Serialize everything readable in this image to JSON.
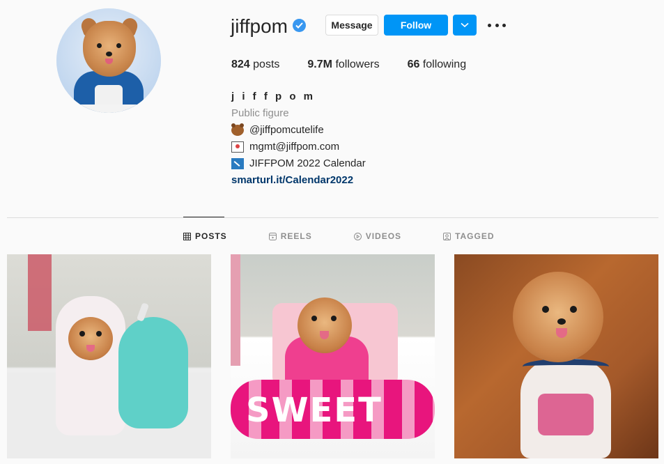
{
  "profile": {
    "username": "jiffpom",
    "verified": true,
    "full_name": "j i f f p o m",
    "category": "Public figure",
    "bio_lines": [
      {
        "icon": "bear-emoji-icon",
        "text": "@jiffpomcutelife"
      },
      {
        "icon": "envelope-emoji-icon",
        "text": "mgmt@jiffpom.com"
      },
      {
        "icon": "calendar-emoji-icon",
        "text": "JIFFPOM 2022 Calendar"
      }
    ],
    "link": "smarturl.it/Calendar2022"
  },
  "actions": {
    "message_label": "Message",
    "follow_label": "Follow"
  },
  "stats": {
    "posts_count": "824",
    "posts_label": "posts",
    "followers_count": "9.7M",
    "followers_label": "followers",
    "following_count": "66",
    "following_label": "following"
  },
  "tabs": [
    {
      "label": "POSTS",
      "icon": "grid-icon",
      "active": true
    },
    {
      "label": "REELS",
      "icon": "reels-icon",
      "active": false
    },
    {
      "label": "VIDEOS",
      "icon": "video-play-icon",
      "active": false
    },
    {
      "label": "TAGGED",
      "icon": "tagged-icon",
      "active": false
    }
  ],
  "colors": {
    "accent": "#0095f6",
    "verified": "#3897f0",
    "link": "#00376b",
    "muted": "#8e8e8e"
  }
}
